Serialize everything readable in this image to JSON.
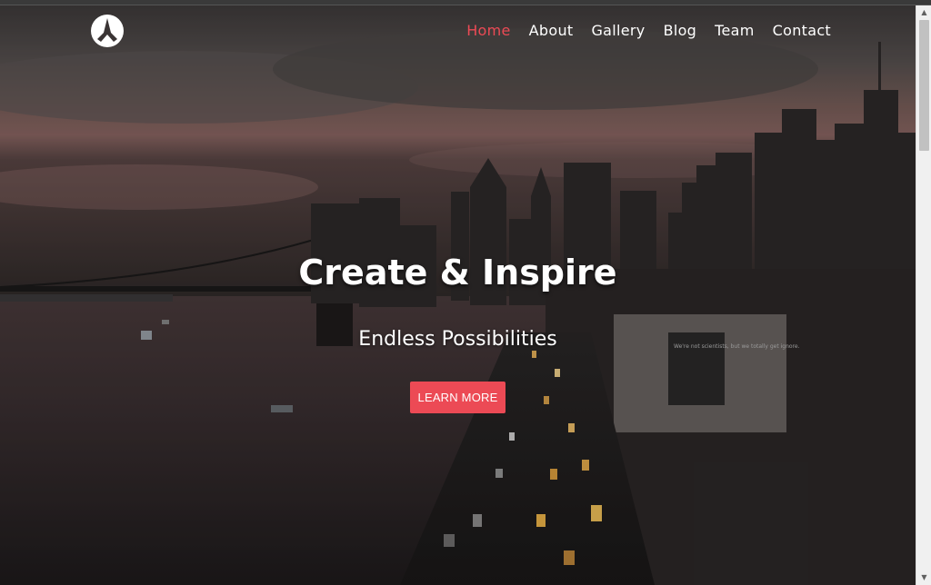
{
  "nav": {
    "items": [
      {
        "label": "Home",
        "active": true
      },
      {
        "label": "About",
        "active": false
      },
      {
        "label": "Gallery",
        "active": false
      },
      {
        "label": "Blog",
        "active": false
      },
      {
        "label": "Team",
        "active": false
      },
      {
        "label": "Contact",
        "active": false
      }
    ],
    "logo_icon": "logo-icon"
  },
  "hero": {
    "title": "Create & Inspire",
    "subtitle": "Endless Possibilities",
    "cta_label": "LEARN MORE",
    "billboard_text": "We're not scientists, but we totally get ignore."
  },
  "colors": {
    "accent": "#ec4a55",
    "text": "#ffffff"
  },
  "scrollbar": {
    "up_icon": "arrow-up-icon",
    "down_icon": "arrow-down-icon"
  }
}
